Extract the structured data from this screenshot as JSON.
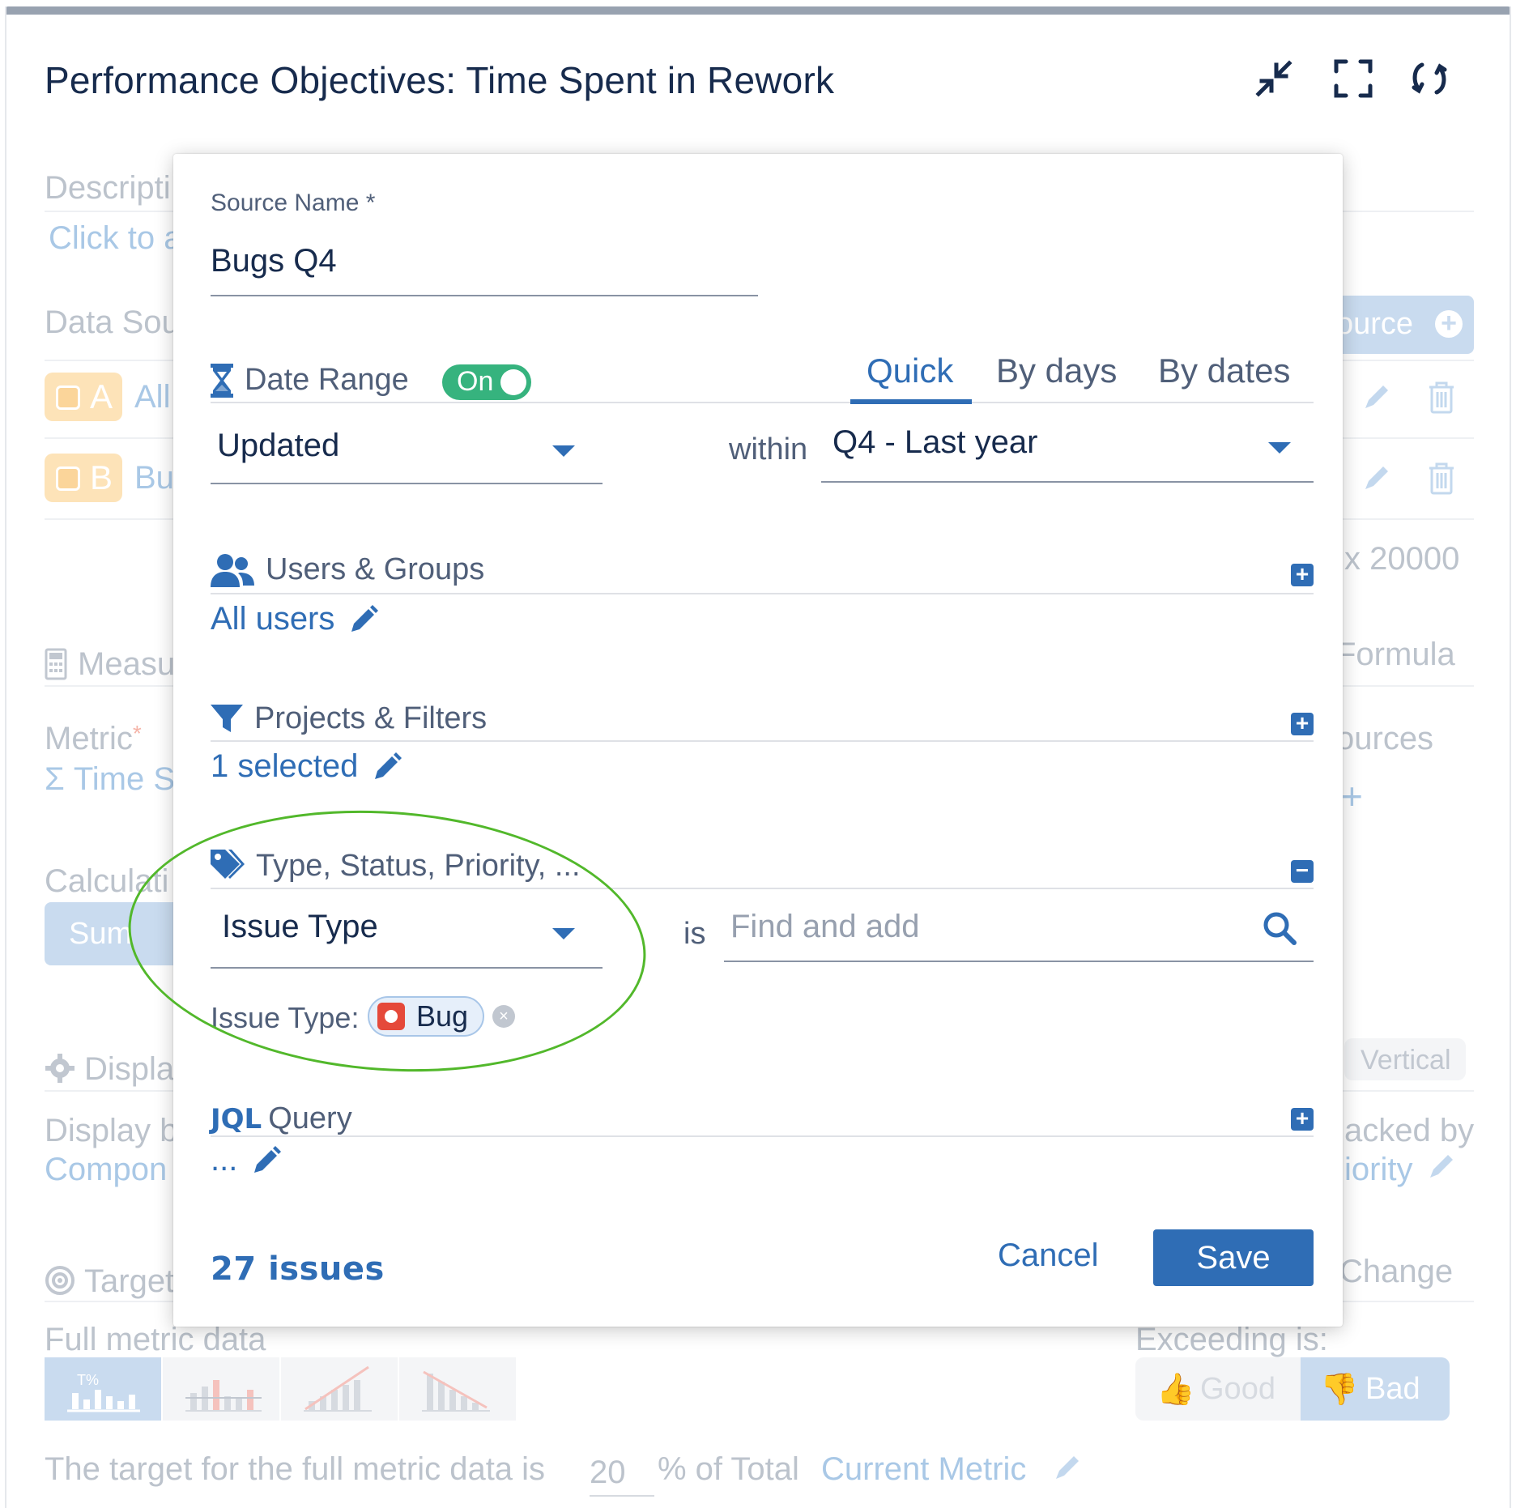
{
  "page": {
    "title": "Performance Objectives: Time Spent in Rework"
  },
  "header_icons": [
    "collapse-icon",
    "fullscreen-icon",
    "refresh-icon"
  ],
  "background": {
    "description_label": "Descripti",
    "description_link": "Click to a",
    "data_sources_label": "Data Sou",
    "add_source_label": "ource",
    "source_a_letter": "A",
    "source_a_name": "All",
    "source_b_letter": "B",
    "source_b_name": "Bu",
    "max_text": "x 20000",
    "measure_label": "Measu",
    "formula_label": "Formula",
    "metric_label": "Metric",
    "metric_required": "*",
    "metric_value": "Σ Time S",
    "sources_label": "ources",
    "calculation_label": "Calculati",
    "sum_button": "Sum",
    "display_label": "Displa",
    "vertical_label": "Vertical",
    "display_by_label": "Display b",
    "display_by_value": "Compon",
    "stacked_by_label": "acked by",
    "stacked_by_value": "iority",
    "target_label": "Target",
    "change_label": "Change",
    "full_metric_label": "Full metric data",
    "exceeding_label": "Exceeding is:",
    "good_label": "Good",
    "bad_label": "Bad",
    "target_sentence_pre": "The target for the full metric data is",
    "target_value": "20",
    "target_sentence_post": "% of Total",
    "current_metric": "Current Metric"
  },
  "modal": {
    "source_name_label": "Source Name *",
    "source_name_value": "Bugs Q4",
    "date_range": {
      "label": "Date Range",
      "toggle": "On",
      "tabs": [
        "Quick",
        "By days",
        "By dates"
      ],
      "active_tab": "Quick",
      "field": "Updated",
      "within_label": "within",
      "period": "Q4 - Last year"
    },
    "users_groups": {
      "title": "Users & Groups",
      "value": "All users"
    },
    "projects_filters": {
      "title": "Projects & Filters",
      "value": "1 selected"
    },
    "type_status": {
      "title": "Type, Status, Priority, ...",
      "field": "Issue Type",
      "is_label": "is",
      "search_placeholder": "Find and add",
      "selected_label": "Issue Type:",
      "selected_chip": "Bug"
    },
    "jql": {
      "title_bold": "JQL",
      "title_rest": "Query",
      "value": "..."
    },
    "footer": {
      "issues_count": "27 issues",
      "cancel": "Cancel",
      "save": "Save"
    }
  },
  "colors": {
    "primary": "#2f6db5",
    "toggle_on": "#36b37e",
    "highlight_ellipse": "#52b82b",
    "bug_red": "#e5493a"
  }
}
